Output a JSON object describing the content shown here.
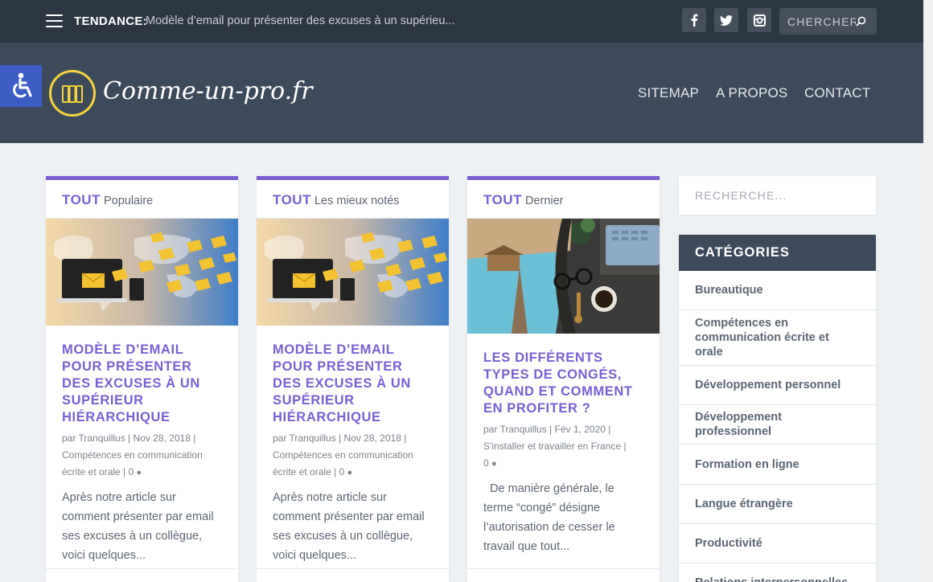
{
  "topbar": {
    "trend_label": "TENDANCE:",
    "trend_text": "Modèle d’email pour présenter des excuses à un supérieu...",
    "social": [
      "facebook-icon",
      "twitter-icon",
      "instagram-icon"
    ],
    "search_placeholder": "CHERCHER"
  },
  "header": {
    "logo_text": "Comme-un-pro.fr",
    "nav": [
      "SITEMAP",
      "A PROPOS",
      "CONTACT"
    ]
  },
  "cards": [
    {
      "tab_bold": "TOUT",
      "tab_label": "Populaire",
      "image": "email-world-map",
      "title": "MODÈLE D’EMAIL POUR PRÉSENTER DES EXCUSES À UN SUPÉRIEUR HIÉRARCHIQUE",
      "meta1": "par Tranquillus | Nov 28, 2018 |",
      "meta2": "Compétences en communication",
      "meta3": "écrite et orale | 0",
      "excerpt": "Après notre article sur comment présenter par email ses excuses à un collègue, voici quelques..."
    },
    {
      "tab_bold": "TOUT",
      "tab_label": "Les mieux notés",
      "image": "email-world-map",
      "title": "MODÈLE D’EMAIL POUR PRÉSENTER DES EXCUSES À UN SUPÉRIEUR HIÉRARCHIQUE",
      "meta1": "par Tranquillus | Nov 28, 2018 |",
      "meta2": "Compétences en communication",
      "meta3": "écrite et orale | 0",
      "excerpt": "Après notre article sur comment présenter par email ses excuses à un collègue, voici quelques..."
    },
    {
      "tab_bold": "TOUT",
      "tab_label": "Dernier",
      "image": "vacation-desk",
      "title": "LES DIFFÉRENTS TYPES DE CONGÉS, QUAND ET COMMENT EN PROFITER ?",
      "meta1": "par Tranquillus | Fév 1, 2020 |",
      "meta2": "S'installer et travailler en France |",
      "meta3": "0",
      "excerpt": "  De manière générale, le terme “congé” désigne l’autorisation de cesser le travail que tout..."
    }
  ],
  "sidebar": {
    "search_placeholder": "RECHERCHE...",
    "categories_title": "CATÉGORIES",
    "categories": [
      "Bureautique",
      "Compétences en communication écrite et orale",
      "Développement personnel",
      "Développement professionnel",
      "Formation en ligne",
      "Langue étrangère",
      "Productivité",
      "Relations interpersonnelles"
    ]
  },
  "colors": {
    "accent": "#7a5fd3",
    "header": "#3d4a5b",
    "topbar": "#2d3744",
    "access": "#3d5cc6",
    "logo": "#f5d43b"
  }
}
